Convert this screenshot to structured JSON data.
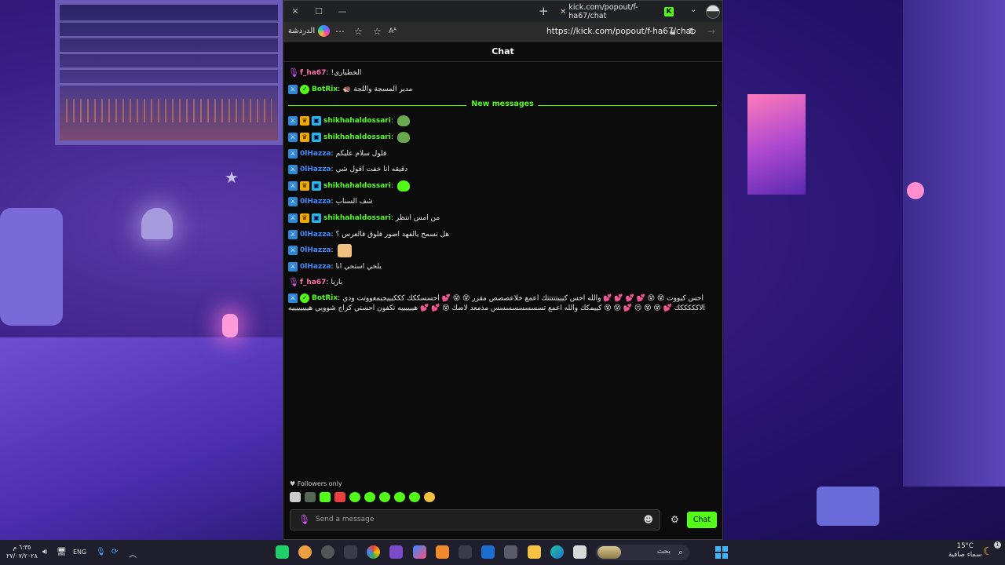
{
  "browser": {
    "tab_title": "kick.com/popout/f-ha67/chat",
    "tab_favicon": "K",
    "url": "https://kick.com/popout/f-ha67/chat",
    "copilot_label": "الدردشة",
    "reader_label": "Aᴬ"
  },
  "chat": {
    "header": "Chat",
    "new_messages_label": "New messages",
    "messages": [
      {
        "user": "f_ha67",
        "color": "#ff6fae",
        "badges": [
          "mic-icon"
        ],
        "text": "الخطباري!"
      },
      {
        "user": "BotRix",
        "color": "#53fc18",
        "badges": [
          "mod-icon",
          "verified-icon"
        ],
        "text": "مدير المسجة واللجة 🦔"
      },
      {
        "user": "shikhahaldossari",
        "color": "#53fc18",
        "badges": [
          "mod-icon",
          "crown-icon",
          "sub-icon"
        ],
        "text": "",
        "emote": "frog-emote"
      },
      {
        "user": "shikhahaldossari",
        "color": "#53fc18",
        "badges": [
          "mod-icon",
          "crown-icon",
          "sub-icon"
        ],
        "text": "",
        "emote": "frog-emote"
      },
      {
        "user": "0lHazza",
        "color": "#3d8bff",
        "badges": [
          "mod-icon"
        ],
        "text": "فلول سلام عليكم"
      },
      {
        "user": "0lHazza",
        "color": "#3d8bff",
        "badges": [
          "mod-icon"
        ],
        "text": "دقيقه انا خفت اقول شي"
      },
      {
        "user": "shikhahaldossari",
        "color": "#53fc18",
        "badges": [
          "mod-icon",
          "crown-icon",
          "sub-icon"
        ],
        "text": "",
        "emote": "green-blob-emote"
      },
      {
        "user": "0lHazza",
        "color": "#3d8bff",
        "badges": [
          "mod-icon"
        ],
        "text": "شف السناب"
      },
      {
        "user": "shikhahaldossari",
        "color": "#53fc18",
        "badges": [
          "mod-icon",
          "crown-icon",
          "sub-icon"
        ],
        "text": "من امس انتظر"
      },
      {
        "user": "0lHazza",
        "color": "#3d8bff",
        "badges": [
          "mod-icon"
        ],
        "text": "هل تسمح يالفهد اصور فلوق فالعرس ؟"
      },
      {
        "user": "0lHazza",
        "color": "#3d8bff",
        "badges": [
          "mod-icon"
        ],
        "text": "",
        "emote": "face-emote"
      },
      {
        "user": "0lHazza",
        "color": "#3d8bff",
        "badges": [
          "mod-icon"
        ],
        "text": "يلخي استحي انا"
      },
      {
        "user": "f_ha67",
        "color": "#ff6fae",
        "badges": [
          "mic-icon"
        ],
        "text": "باربا"
      },
      {
        "user": "BotRix",
        "color": "#53fc18",
        "badges": [
          "mod-icon",
          "verified-icon"
        ],
        "text": "احس كيووت 😵 😵 💕 💕 💕 💕 والله احس كيييتتتتتك اعمع خلاعصصص مقرر 😵 😵 💕 احسسككك كككيييجيمعووتت ودي الاكككككك 💕 😵 😵 😣 💕 😵 😵 كييمكك والله اعمع تسسسسسسسس مدمعد لاضك 😵 💕 💕 هييييييه تكفون احسني كزاج شوويي هييييييييه",
        "multiline": true
      }
    ],
    "followers_only_label": "Followers only",
    "input_placeholder": "Send a message",
    "send_button_label": "Chat",
    "emote_bar": [
      "#cccccc",
      "#556655",
      "#53fc18",
      "#e84040",
      "#53fc18",
      "#53fc18",
      "#53fc18",
      "#53fc18",
      "#53fc18",
      "#f2c040"
    ]
  },
  "taskbar": {
    "clock_time": "٦:٣٥ م",
    "clock_date": "٢٧/٠٧/٢٠٢٨",
    "language": "ENG",
    "search_label": "بحث",
    "weather_temp": "15°C",
    "weather_desc": "سماء صافية",
    "notification_count": "1"
  }
}
